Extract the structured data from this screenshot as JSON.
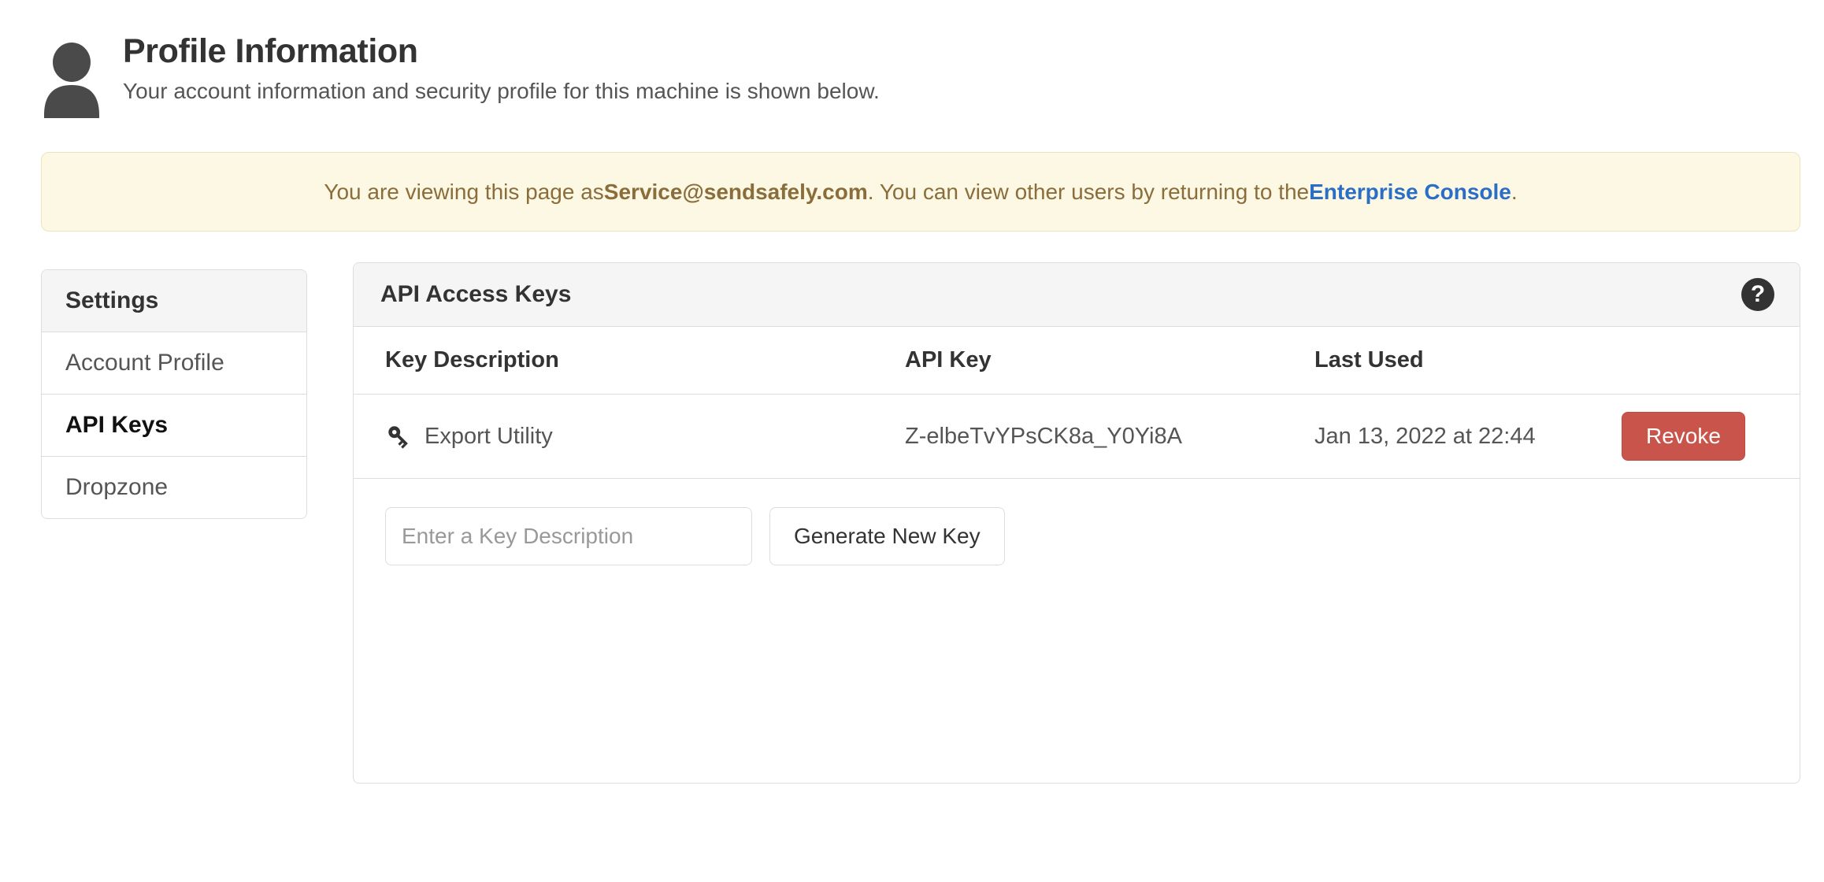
{
  "header": {
    "title": "Profile Information",
    "subtitle": "Your account information and security profile for this machine is shown below.",
    "avatar_icon": "user-avatar-icon"
  },
  "alert": {
    "text_before": "You are viewing this page as ",
    "account_email": "Service@sendsafely.com",
    "text_middle": ". You can view other users by returning to the ",
    "link_label": "Enterprise Console",
    "text_after": ".",
    "background_color": "#FCF8E3",
    "text_color": "#8A6D3B",
    "link_color": "#2B6EC6"
  },
  "sidebar": {
    "header": "Settings",
    "items": [
      {
        "label": "Account Profile",
        "active": false
      },
      {
        "label": "API Keys",
        "active": true
      },
      {
        "label": "Dropzone",
        "active": false
      }
    ]
  },
  "panel": {
    "title": "API Access Keys",
    "help_icon": "question-mark-help-icon",
    "table": {
      "columns": [
        "Key Description",
        "API Key",
        "Last Used",
        ""
      ],
      "rows": [
        {
          "icon": "key-icon",
          "description": "Export Utility",
          "api_key": "Z-elbeTvYPsCK8a_Y0Yi8A",
          "last_used": "Jan 13, 2022 at 22:44",
          "action_label": "Revoke",
          "action_color": "#C9544B"
        }
      ]
    },
    "new_key_form": {
      "input_placeholder": "Enter a Key Description",
      "input_value": "",
      "button_label": "Generate New Key"
    }
  }
}
